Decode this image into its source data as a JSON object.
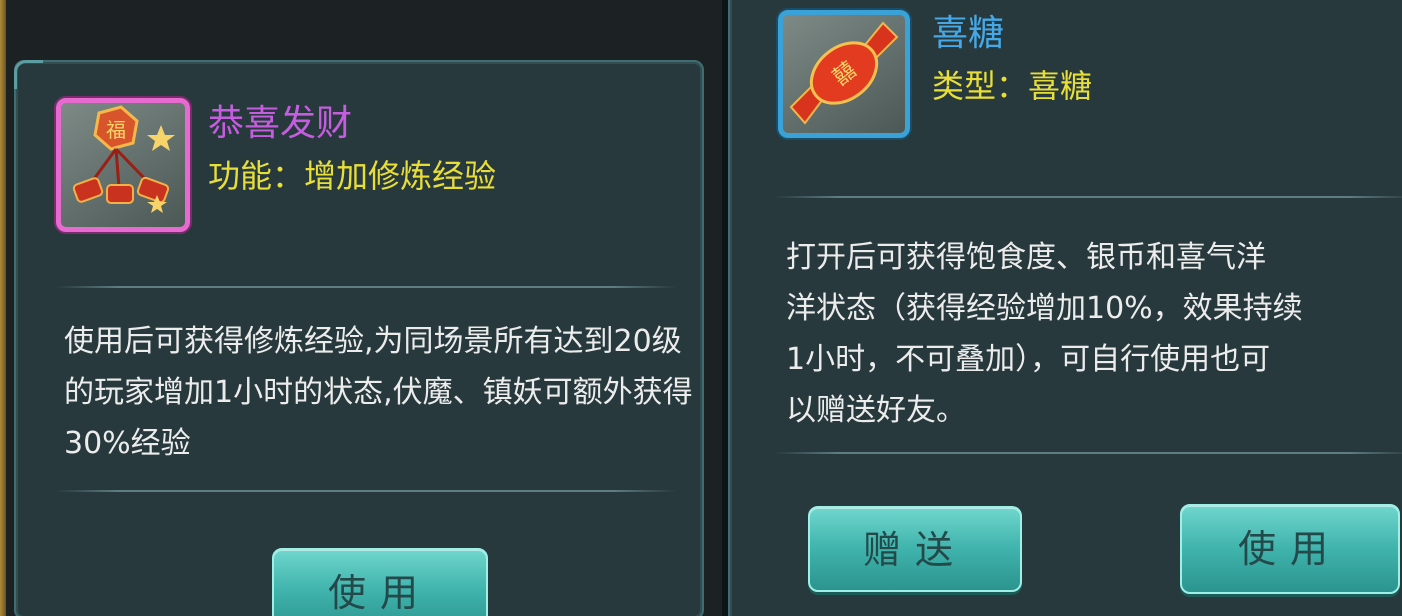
{
  "left_tooltip": {
    "item_name": "恭喜发财",
    "subtitle": "功能：增加修炼经验",
    "description": "使用后可获得修炼经验,为同场景所有达到20级的玩家增加1小时的状态,伏魔、镇妖可额外获得30%经验",
    "use_button": "使用",
    "icon": "firecracker-icon",
    "rarity_color": "#e76ad0"
  },
  "right_tooltip": {
    "item_name": "喜糖",
    "subtitle": "类型：喜糖",
    "description": "打开后可获得饱食度、银币和喜气洋\n洋状态（获得经验增加10%，效果持续\n1小时，不可叠加），可自行使用也可\n以赠送好友。",
    "gift_button": "赠送",
    "use_button": "使用",
    "icon": "wedding-candy-icon",
    "rarity_color": "#3aa2d6"
  }
}
